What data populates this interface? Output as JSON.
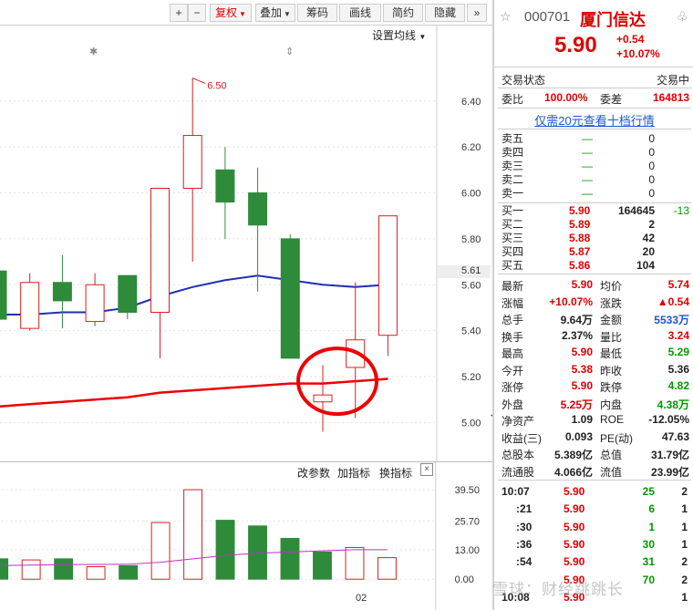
{
  "toolbar": {
    "plus": "+",
    "minus": "−",
    "fuquan": "复权",
    "diejia": "叠加",
    "chouma": "筹码",
    "huaxian": "画线",
    "jianyue": "简约",
    "yincang": "隐藏",
    "expand": "»"
  },
  "settings_ma": "设置均线",
  "markers": [
    "✱",
    "⇕"
  ],
  "chart": {
    "high_label": "6.50",
    "current_price_label": "5.61",
    "date_label": "02",
    "y_ticks": [
      "6.40",
      "6.20",
      "6.00",
      "5.80",
      "5.60",
      "5.40",
      "5.20",
      "5.00"
    ],
    "vol_ticks": [
      "39.50",
      "25.70",
      "13.00",
      "0.00"
    ]
  },
  "chart_data": {
    "type": "candlestick",
    "ylim": [
      4.95,
      6.55
    ],
    "candles": [
      {
        "open": 5.45,
        "high": 5.68,
        "low": 5.4,
        "close": 5.66,
        "dir": "down"
      },
      {
        "open": 5.41,
        "high": 5.65,
        "low": 5.4,
        "close": 5.61,
        "dir": "up"
      },
      {
        "open": 5.61,
        "high": 5.73,
        "low": 5.41,
        "close": 5.53,
        "dir": "down"
      },
      {
        "open": 5.44,
        "high": 5.65,
        "low": 5.42,
        "close": 5.6,
        "dir": "up"
      },
      {
        "open": 5.64,
        "high": 5.64,
        "low": 5.45,
        "close": 5.48,
        "dir": "down"
      },
      {
        "open": 5.48,
        "high": 6.02,
        "low": 5.28,
        "close": 6.02,
        "dir": "up"
      },
      {
        "open": 6.02,
        "high": 6.5,
        "low": 5.7,
        "close": 6.25,
        "dir": "up"
      },
      {
        "open": 6.1,
        "high": 6.2,
        "low": 5.8,
        "close": 5.96,
        "dir": "down"
      },
      {
        "open": 6.0,
        "high": 6.11,
        "low": 5.57,
        "close": 5.86,
        "dir": "down"
      },
      {
        "open": 5.8,
        "high": 5.82,
        "low": 5.35,
        "close": 5.28,
        "dir": "down"
      },
      {
        "open": 5.09,
        "high": 5.25,
        "low": 4.96,
        "close": 5.12,
        "dir": "up"
      },
      {
        "open": 5.24,
        "high": 5.61,
        "low": 5.02,
        "close": 5.36,
        "dir": "up"
      },
      {
        "open": 5.38,
        "high": 5.9,
        "low": 5.29,
        "close": 5.9,
        "dir": "up"
      }
    ],
    "ma_blue": [
      5.47,
      5.47,
      5.48,
      5.48,
      5.5,
      5.55,
      5.59,
      5.62,
      5.64,
      5.62,
      5.6,
      5.59,
      5.6
    ],
    "ma_red": [
      5.07,
      5.08,
      5.09,
      5.1,
      5.11,
      5.13,
      5.14,
      5.15,
      5.16,
      5.17,
      5.17,
      5.18,
      5.19
    ],
    "volumes": [
      {
        "v": 9.0,
        "dir": "down"
      },
      {
        "v": 8.5,
        "dir": "up"
      },
      {
        "v": 9.0,
        "dir": "down"
      },
      {
        "v": 5.5,
        "dir": "up"
      },
      {
        "v": 6.0,
        "dir": "down"
      },
      {
        "v": 25.0,
        "dir": "up"
      },
      {
        "v": 39.5,
        "dir": "up"
      },
      {
        "v": 26.0,
        "dir": "down"
      },
      {
        "v": 23.5,
        "dir": "down"
      },
      {
        "v": 18.0,
        "dir": "down"
      },
      {
        "v": 12.0,
        "dir": "down"
      },
      {
        "v": 14.0,
        "dir": "up"
      },
      {
        "v": 9.5,
        "dir": "up"
      }
    ],
    "vol_ma": [
      6.0,
      6.2,
      6.4,
      6.5,
      6.6,
      7.5,
      9.0,
      10.5,
      11.5,
      12.0,
      12.5,
      13.0,
      13.0
    ],
    "vol_ylim": [
      0,
      42
    ]
  },
  "sub_header": {
    "gai_canshu": "改参数",
    "jia_zhibiao": "加指标",
    "huan_zhibiao": "换指标",
    "close": "×"
  },
  "stock": {
    "code": "000701",
    "name": "厦门信达",
    "price": "5.90",
    "change": "+0.54",
    "change_pct": "+10.07%",
    "star": "☆",
    "bell": "♧"
  },
  "status": {
    "label": "交易状态",
    "value": "交易中"
  },
  "weibi": {
    "label": "委比",
    "value": "100.00%",
    "diff_label": "委差",
    "diff_value": "164813"
  },
  "ten_level_link": "仅需20元查看十档行情",
  "sell_orders": [
    {
      "label": "卖五",
      "price": "—",
      "vol": "0"
    },
    {
      "label": "卖四",
      "price": "—",
      "vol": "0"
    },
    {
      "label": "卖三",
      "price": "—",
      "vol": "0"
    },
    {
      "label": "卖二",
      "price": "—",
      "vol": "0"
    },
    {
      "label": "卖一",
      "price": "—",
      "vol": "0"
    }
  ],
  "buy_orders": [
    {
      "label": "买一",
      "price": "5.90",
      "vol": "164645",
      "delta": "-13"
    },
    {
      "label": "买二",
      "price": "5.89",
      "vol": "2",
      "delta": ""
    },
    {
      "label": "买三",
      "price": "5.88",
      "vol": "42",
      "delta": ""
    },
    {
      "label": "买四",
      "price": "5.87",
      "vol": "20",
      "delta": ""
    },
    {
      "label": "买五",
      "price": "5.86",
      "vol": "104",
      "delta": ""
    }
  ],
  "stats": [
    {
      "l1": "最新",
      "v1": "5.90",
      "c1": "red",
      "l2": "均价",
      "v2": "5.74",
      "c2": "red"
    },
    {
      "l1": "涨幅",
      "v1": "+10.07%",
      "c1": "red",
      "l2": "涨跌",
      "v2": "▲0.54",
      "c2": "red"
    },
    {
      "l1": "总手",
      "v1": "9.64万",
      "c1": "",
      "l2": "金额",
      "v2": "5533万",
      "c2": "blue"
    },
    {
      "l1": "换手",
      "v1": "2.37%",
      "c1": "",
      "l2": "量比",
      "v2": "3.24",
      "c2": "red"
    },
    {
      "l1": "最高",
      "v1": "5.90",
      "c1": "red",
      "l2": "最低",
      "v2": "5.29",
      "c2": "green"
    },
    {
      "l1": "今开",
      "v1": "5.38",
      "c1": "red",
      "l2": "昨收",
      "v2": "5.36",
      "c2": ""
    },
    {
      "l1": "涨停",
      "v1": "5.90",
      "c1": "red",
      "l2": "跌停",
      "v2": "4.82",
      "c2": "green"
    },
    {
      "l1": "外盘",
      "v1": "5.25万",
      "c1": "red",
      "l2": "内盘",
      "v2": "4.38万",
      "c2": "green"
    },
    {
      "l1": "净资产",
      "v1": "1.09",
      "c1": "",
      "l2": "ROE",
      "v2": "-12.05%",
      "c2": ""
    },
    {
      "l1": "收益(三)",
      "v1": "0.093",
      "c1": "",
      "l2": "PE(动)",
      "v2": "47.63",
      "c2": ""
    },
    {
      "l1": "总股本",
      "v1": "5.389亿",
      "c1": "",
      "l2": "总值",
      "v2": "31.79亿",
      "c2": ""
    },
    {
      "l1": "流通股",
      "v1": "4.066亿",
      "c1": "",
      "l2": "流值",
      "v2": "23.99亿",
      "c2": ""
    }
  ],
  "ticks": [
    {
      "time": "10:07",
      "price": "5.90",
      "vol": "25",
      "n": "2"
    },
    {
      "time": ":21",
      "price": "5.90",
      "vol": "6",
      "n": "1"
    },
    {
      "time": ":30",
      "price": "5.90",
      "vol": "1",
      "n": "1"
    },
    {
      "time": ":36",
      "price": "5.90",
      "vol": "30",
      "n": "1"
    },
    {
      "time": ":54",
      "price": "5.90",
      "vol": "31",
      "n": "2"
    },
    {
      "time": "",
      "price": "5.90",
      "vol": "70",
      "n": "2"
    },
    {
      "time": "10:08",
      "price": "5.90",
      "vol": "",
      "n": "1"
    }
  ],
  "watermark": "雪球：财经跳跳长"
}
